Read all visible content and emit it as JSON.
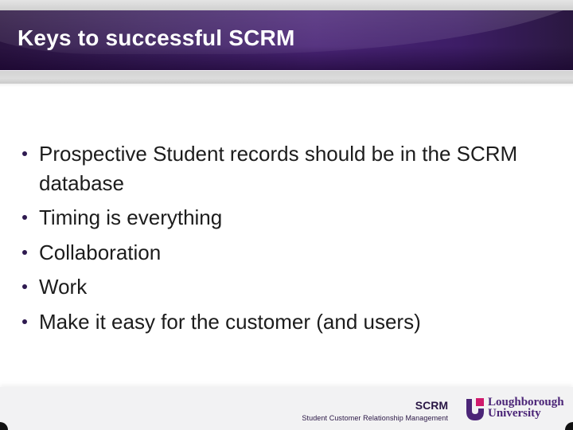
{
  "slide": {
    "title": "Keys to successful SCRM",
    "bullets": [
      "Prospective Student records should be in the SCRM database",
      "Timing is everything",
      "Collaboration",
      "Work",
      "Make it easy for the customer (and users)"
    ]
  },
  "footer": {
    "abbreviation": "SCRM",
    "full_name": "Student Customer Relationship Management",
    "logo": {
      "line1": "Loughborough",
      "line2": "University",
      "icon": "loughborough-shield-icon"
    }
  },
  "colors": {
    "header_purple": "#3a1f5c",
    "bullet": "#2e1a50",
    "text": "#1c1c1c",
    "logo_purple": "#4b2577",
    "logo_pink": "#d0196c"
  }
}
